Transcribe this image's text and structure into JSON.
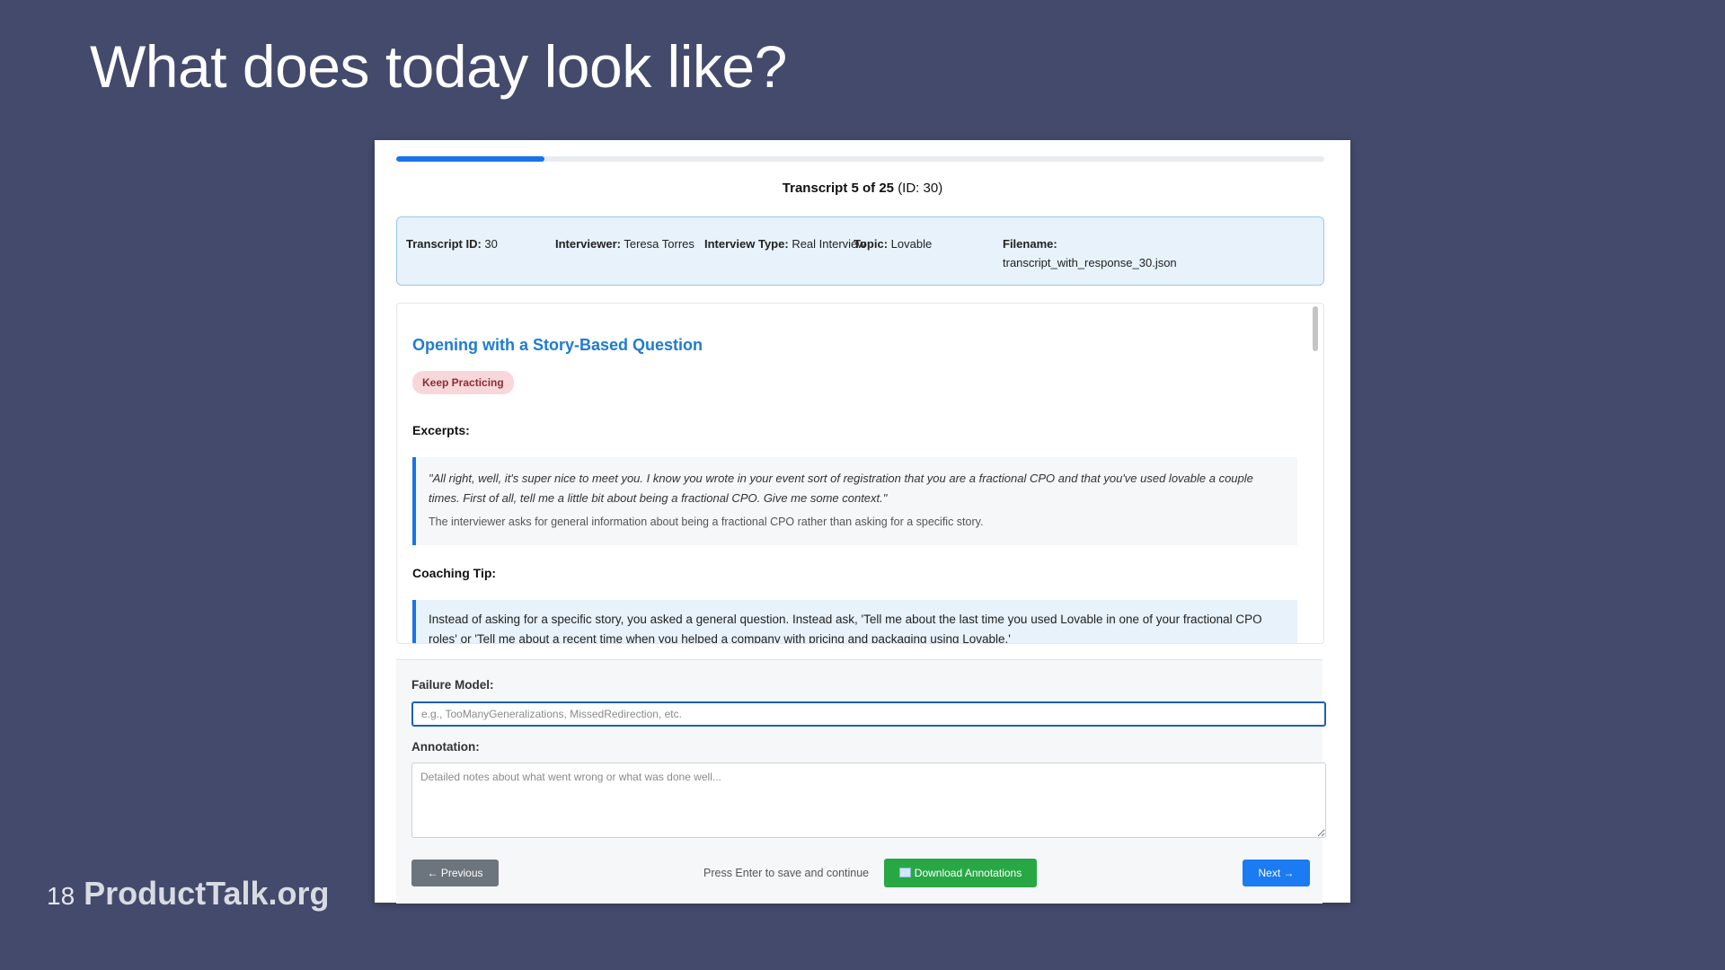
{
  "slide": {
    "title": "What does today look like?",
    "page_number": "18",
    "brand": "ProductTalk.org"
  },
  "progress": {
    "fraction": 0.16
  },
  "counter": {
    "main": "Transcript 5 of 25",
    "id": "(ID: 30)"
  },
  "meta": {
    "transcript_id_label": "Transcript ID:",
    "transcript_id": "30",
    "interviewer_label": "Interviewer:",
    "interviewer": "Teresa Torres",
    "interview_type_label": "Interview Type:",
    "interview_type": "Real Interview",
    "topic_label": "Topic:",
    "topic": "Lovable",
    "filename_label": "Filename:",
    "filename": "transcript_with_response_30.json"
  },
  "section": {
    "title": "Opening with a Story-Based Question",
    "badge": "Keep Practicing",
    "excerpts_label": "Excerpts:",
    "excerpt_quote": "\"All right, well, it's super nice to meet you. I know you wrote in your event sort of registration that you are a fractional CPO and that you've used lovable a couple times. First of all, tell me a little bit about being a fractional CPO. Give me some context.\"",
    "excerpt_note": "The interviewer asks for general information about being a fractional CPO rather than asking for a specific story.",
    "coaching_label": "Coaching Tip:",
    "coaching_tip": "Instead of asking for a specific story, you asked a general question. Instead ask, 'Tell me about the last time you used Lovable in one of your fractional CPO roles' or 'Tell me about a recent time when you helped a company with pricing and packaging using Lovable.'"
  },
  "form": {
    "failure_label": "Failure Model:",
    "failure_placeholder": "e.g., TooManyGeneralizations, MissedRedirection, etc.",
    "annotation_label": "Annotation:",
    "annotation_placeholder": "Detailed notes about what went wrong or what was done well...",
    "prev_label": "← Previous",
    "hint": "Press Enter to save and continue",
    "download_label": "Download Annotations",
    "next_label": "Next →"
  },
  "colors": {
    "background": "#434a6b",
    "accent": "#1a73e8",
    "success": "#28a745",
    "badge_bg": "#f8d7da"
  }
}
